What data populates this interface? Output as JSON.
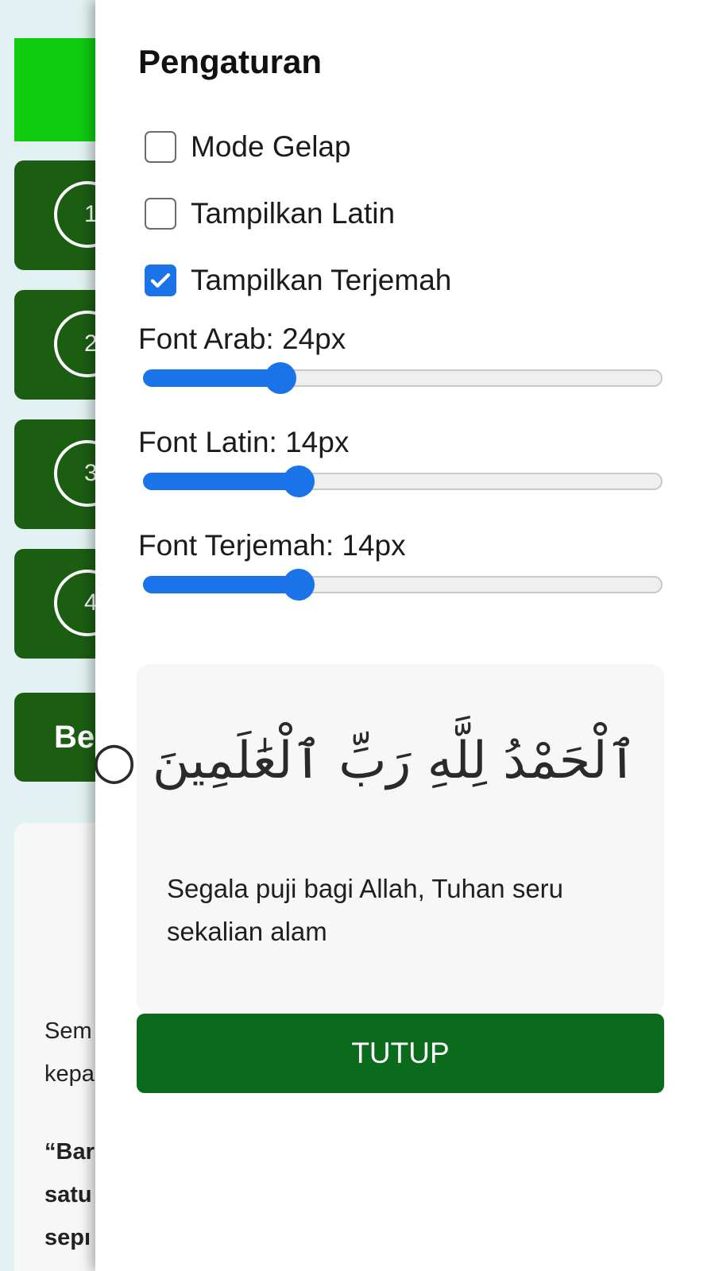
{
  "background": {
    "cards": [
      {
        "number": "1"
      },
      {
        "number": "2"
      },
      {
        "number": "3"
      },
      {
        "number": "4"
      }
    ],
    "wide_card_text": "Be",
    "text_lines": [
      "Sem",
      "kepa",
      "“Bar",
      "satu",
      "sepı"
    ]
  },
  "settings": {
    "title": "Pengaturan",
    "options": [
      {
        "label": "Mode Gelap",
        "checked": false
      },
      {
        "label": "Tampilkan Latin",
        "checked": false
      },
      {
        "label": "Tampilkan Terjemah",
        "checked": true
      }
    ],
    "sliders": [
      {
        "label": "Font Arab: 24px",
        "value": 24,
        "fraction": 0.265
      },
      {
        "label": "Font Latin: 14px",
        "value": 14,
        "fraction": 0.3
      },
      {
        "label": "Font Terjemah: 14px",
        "value": 14,
        "fraction": 0.3
      }
    ],
    "preview": {
      "arabic": "ٱلْحَمْدُ لِلَّهِ رَبِّ ٱلْعَٰلَمِينَ ○",
      "translation": "Segala puji bagi Allah, Tuhan seru sekalian alam"
    },
    "close_label": "TUTUP"
  },
  "colors": {
    "accent": "#1a73e8",
    "header_green": "#0fcc10",
    "card_green": "#1b5e12",
    "button_green": "#0b6b1c"
  }
}
